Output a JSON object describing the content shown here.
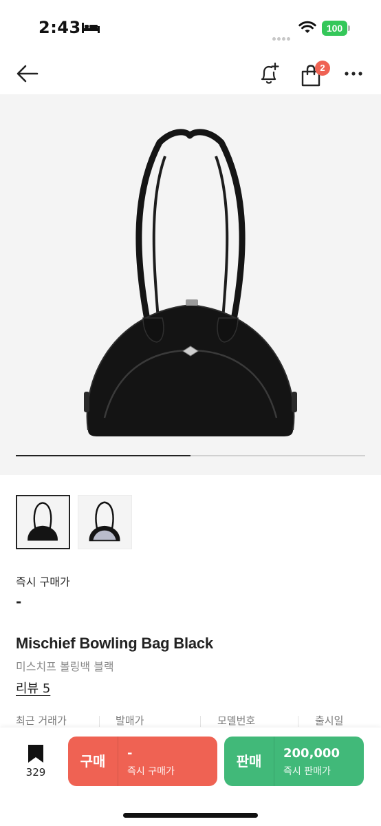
{
  "status_bar": {
    "time": "2:43",
    "battery": "100",
    "icons": [
      "bed-icon",
      "signal-dots-icon",
      "wifi-icon",
      "battery-icon"
    ]
  },
  "nav": {
    "icons": [
      "back-arrow-icon",
      "bell-plus-icon",
      "shopping-bag-icon",
      "more-horizontal-icon"
    ],
    "cart_badge": "2"
  },
  "gallery": {
    "current_index": 1,
    "total": 2,
    "progress_fraction": 0.5
  },
  "instant_buy": {
    "label": "즉시 구매가",
    "value": "-"
  },
  "product": {
    "title": "Mischief Bowling Bag Black",
    "subtitle": "미스치프 볼링백 블랙",
    "review": "리뷰 5"
  },
  "info_columns": [
    "최근 거래가",
    "발매가",
    "모델번호",
    "출시일"
  ],
  "bottom": {
    "wish_count": "329",
    "buy": {
      "label": "구매",
      "price": "-",
      "sub": "즉시 구매가"
    },
    "sell": {
      "label": "판매",
      "price": "200,000",
      "sub": "즉시 판매가"
    }
  },
  "colors": {
    "buy": "#ef6253",
    "sell": "#41b979",
    "badge": "#ef6253",
    "battery": "#34c759"
  }
}
